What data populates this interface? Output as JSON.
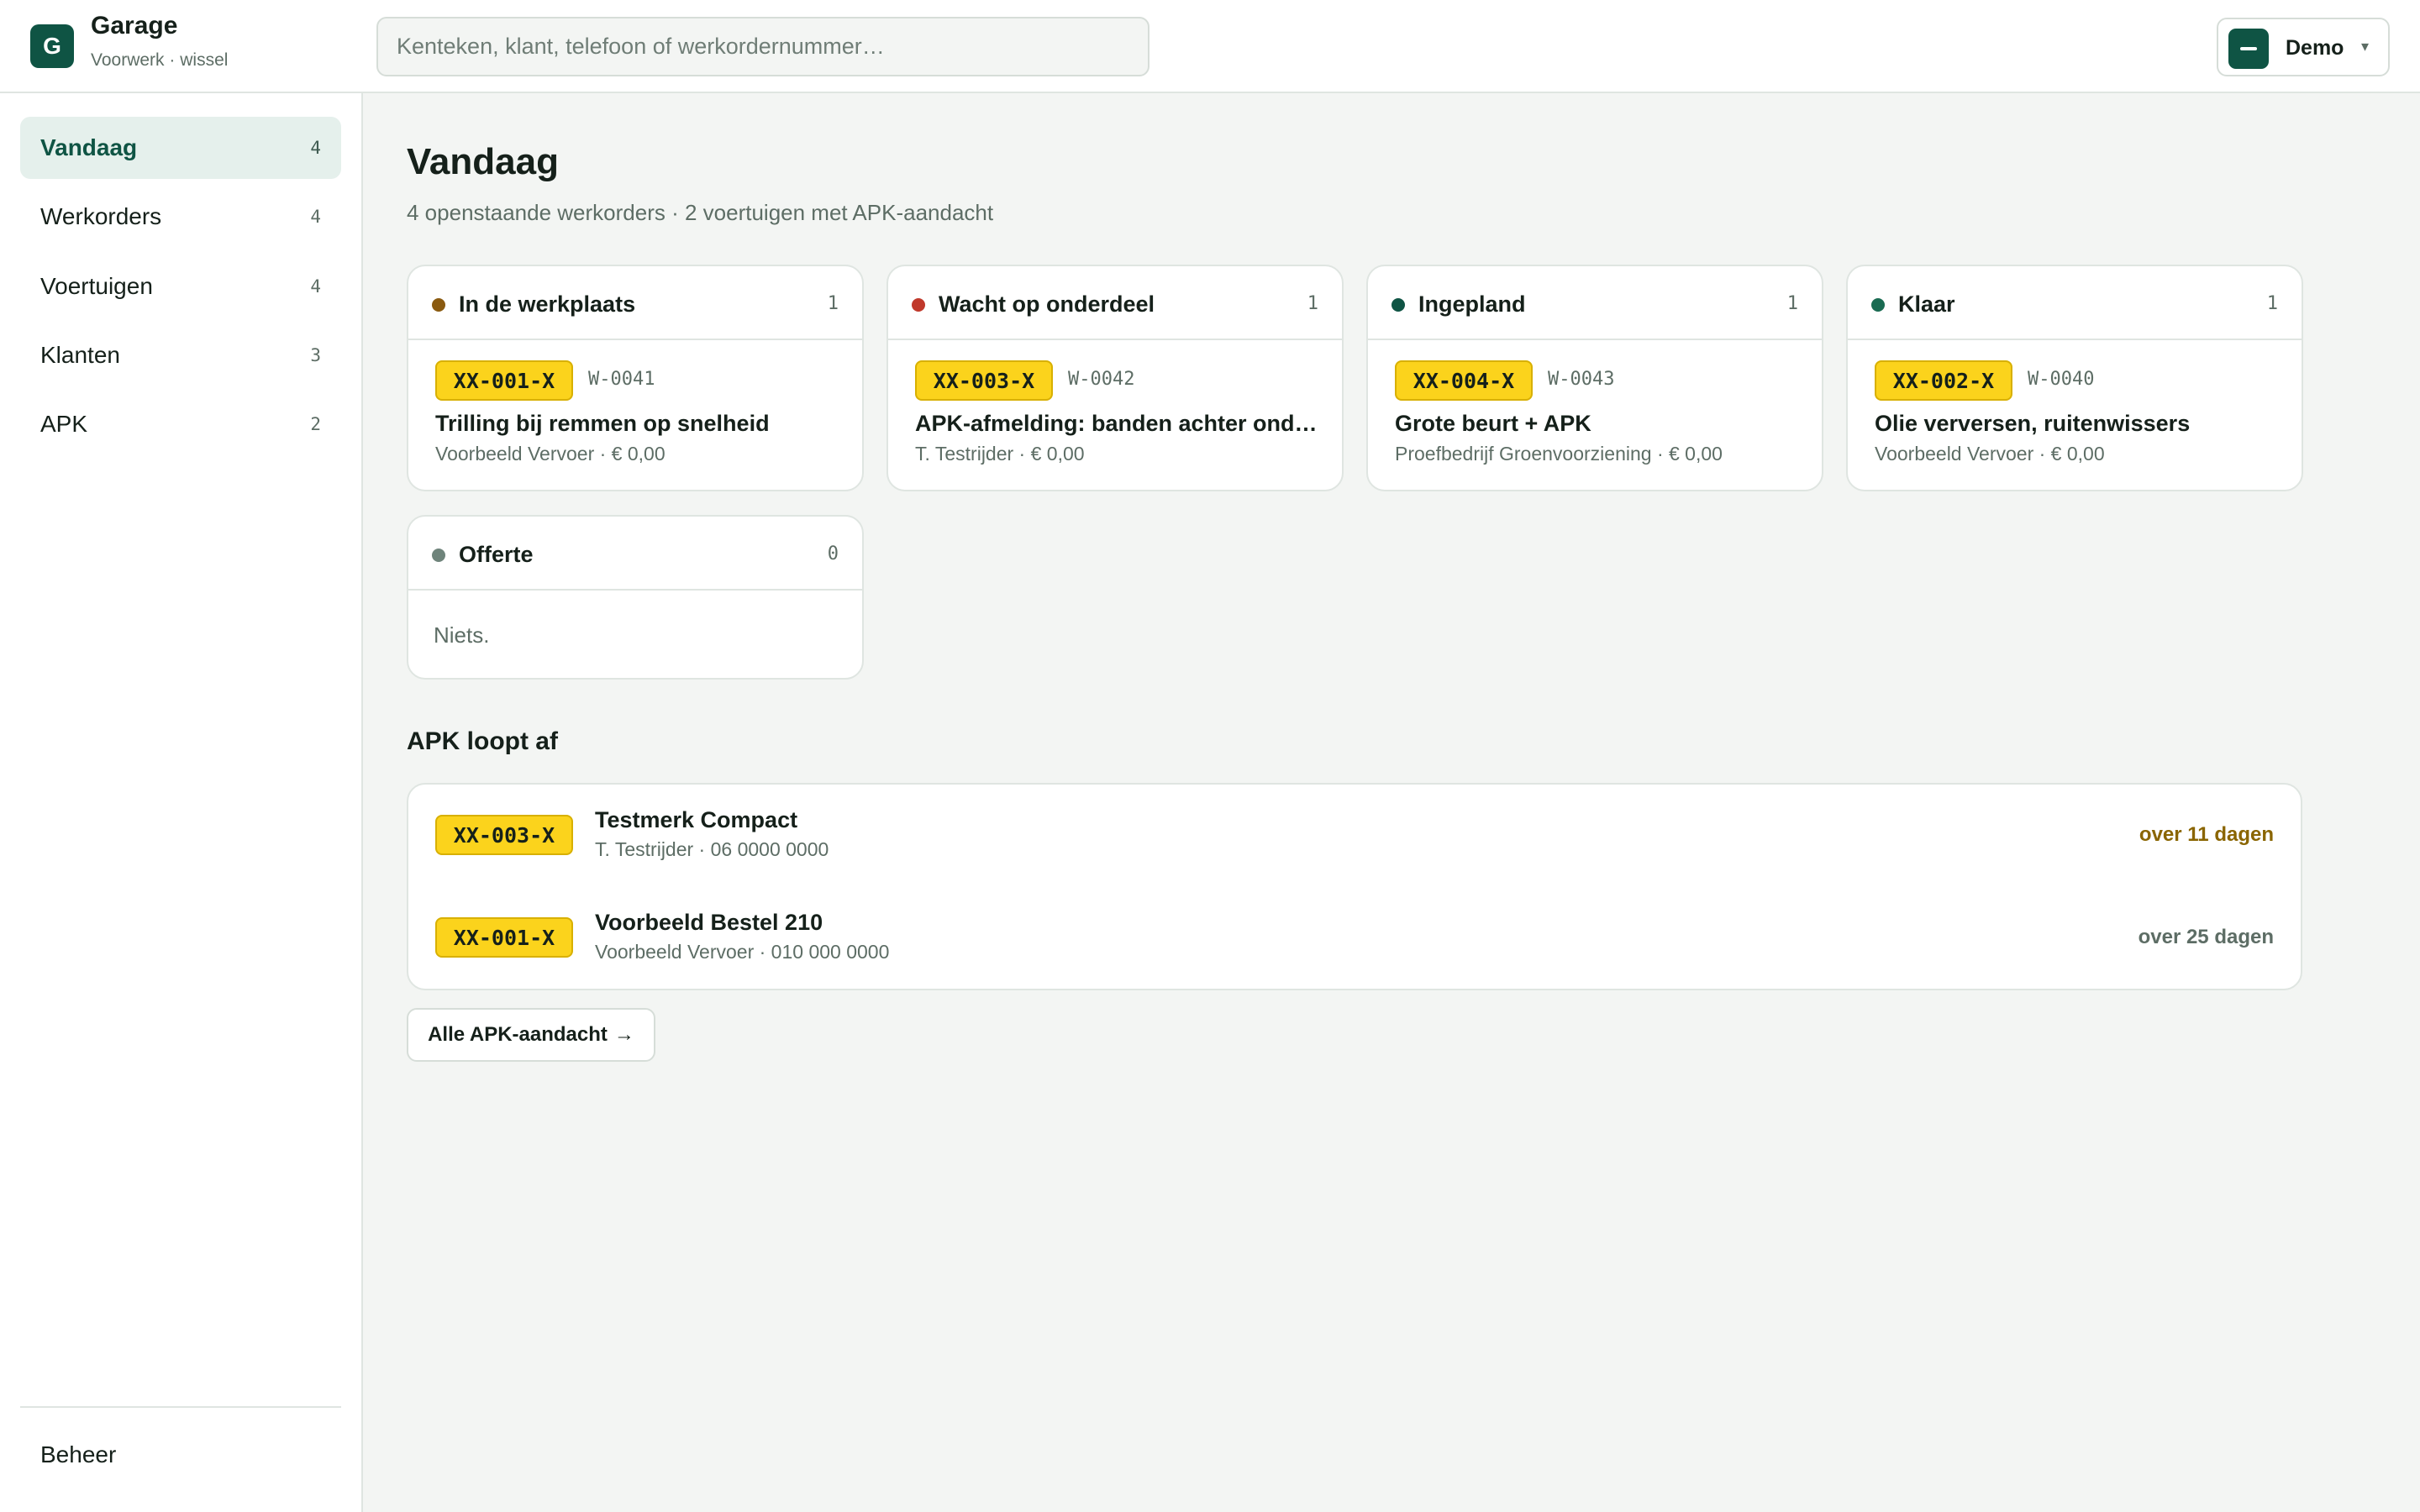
{
  "brand": {
    "logo_letter": "G",
    "name": "Garage",
    "org": "Voorwerk",
    "separator": "·",
    "switch_label": "wissel",
    "color": "#0f5444"
  },
  "search": {
    "placeholder": "Kenteken, klant, telefoon of werkordernummer…",
    "value": ""
  },
  "account": {
    "name": "Demo",
    "caret": "▾"
  },
  "sidebar": {
    "items": [
      {
        "label": "Vandaag",
        "count": "4",
        "active": true
      },
      {
        "label": "Werkorders",
        "count": "4"
      },
      {
        "label": "Voertuigen",
        "count": "4"
      },
      {
        "label": "Klanten",
        "count": "3"
      },
      {
        "label": "APK",
        "count": "2"
      }
    ],
    "footer_item": "Beheer"
  },
  "main": {
    "title": "Vandaag",
    "subtitle": "4 openstaande werkorders · 2 voertuigen met APK-aandacht"
  },
  "columns": [
    {
      "title": "In de werkplaats",
      "count": "1",
      "color": "#8a5a10",
      "plate": "XX-001-X",
      "wo": "W-0041",
      "job": "Trilling bij remmen op snelheid",
      "meta": "Voorbeeld Vervoer · € 0,00"
    },
    {
      "title": "Wacht op onderdeel",
      "count": "1",
      "color": "#c0392b",
      "plate": "XX-003-X",
      "wo": "W-0042",
      "job": "APK-afmelding: banden achter ond…",
      "meta": "T. Testrijder · € 0,00"
    },
    {
      "title": "Ingepland",
      "count": "1",
      "color": "#0f5444",
      "plate": "XX-004-X",
      "wo": "W-0043",
      "job": "Grote beurt + APK",
      "meta": "Proefbedrijf Groenvoorziening · € 0,00"
    },
    {
      "title": "Klaar",
      "count": "1",
      "color": "#1a6b52",
      "plate": "XX-002-X",
      "wo": "W-0040",
      "job": "Olie verversen, ruitenwissers",
      "meta": "Voorbeeld Vervoer · € 0,00"
    },
    {
      "title": "Offerte",
      "count": "0",
      "color": "#6f847b",
      "empty": "Niets."
    }
  ],
  "apk": {
    "title": "APK loopt af",
    "rows": [
      {
        "plate": "XX-003-X",
        "model": "Testmerk Compact",
        "meta": "T. Testrijder · 06 0000 0000",
        "due": "over 11 dagen",
        "due_color": "#8a6500"
      },
      {
        "plate": "XX-001-X",
        "model": "Voorbeeld Bestel 210",
        "meta": "Voorbeeld Vervoer · 010 000 0000",
        "due": "over 25 dagen",
        "due_color": "#5d6d65"
      }
    ],
    "button_label": "Alle APK-aandacht",
    "button_arrow": "→"
  }
}
